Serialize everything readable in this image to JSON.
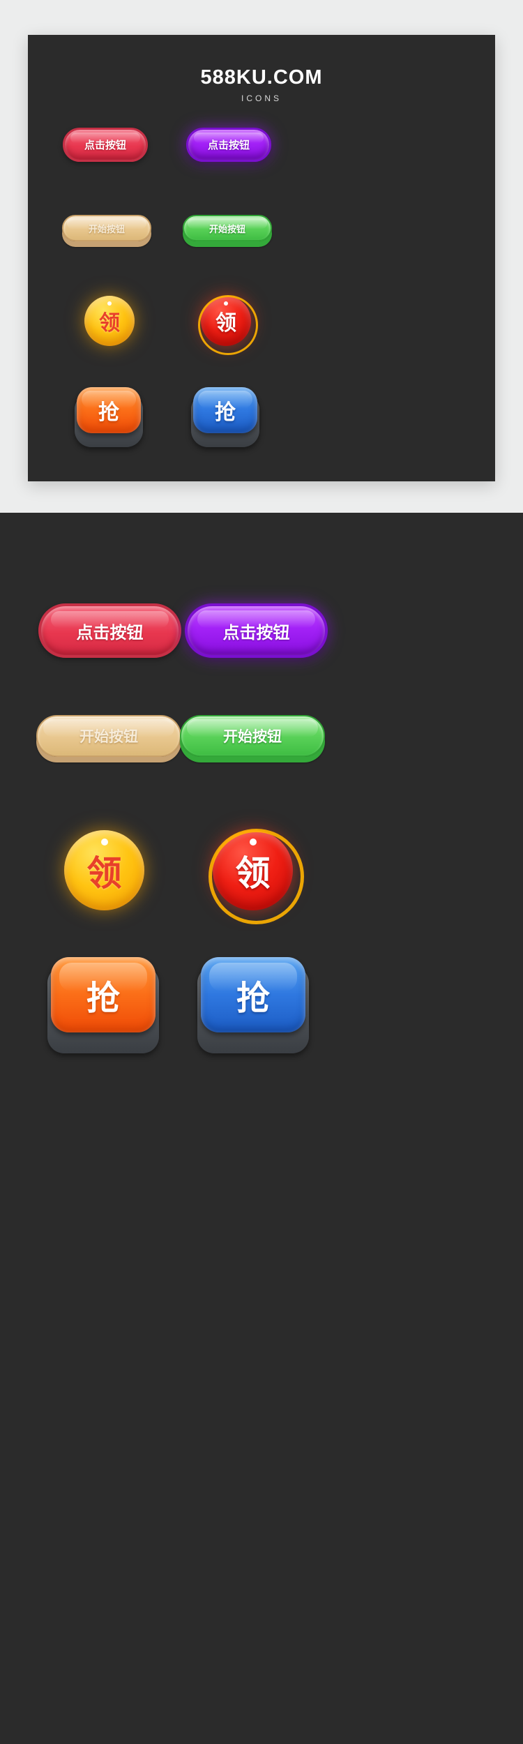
{
  "brand": {
    "title": "588KU.COM",
    "subtitle": "ICONS"
  },
  "buttons": {
    "click_pink": "点击按钮",
    "click_purple": "点击按钮",
    "start_tan": "开始按钮",
    "start_green": "开始按钮",
    "coin_yellow": "领",
    "coin_red": "领",
    "key_orange": "抢",
    "key_blue": "抢"
  },
  "colors": {
    "card_bg": "#2b2b2b",
    "page_bg": "#eceded",
    "pink": "#e8374f",
    "purple": "#a322f7",
    "tan": "#e9c890",
    "green": "#5cd35a",
    "yellow": "#ffc412",
    "red": "#f01f14",
    "orange": "#fb6e18",
    "blue": "#2f78e0"
  }
}
